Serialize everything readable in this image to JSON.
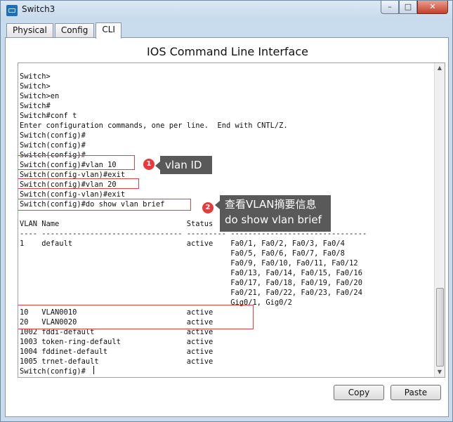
{
  "window": {
    "title": "Switch3",
    "minimize": "–",
    "maximize": "□",
    "close": "✕"
  },
  "tabs": [
    {
      "label": "Physical"
    },
    {
      "label": "Config"
    },
    {
      "label": "CLI"
    }
  ],
  "panel": {
    "title": "IOS Command Line Interface"
  },
  "terminal": {
    "lines": [
      "Switch>",
      "Switch>",
      "Switch>en",
      "Switch#",
      "Switch#conf t",
      "Enter configuration commands, one per line.  End with CNTL/Z.",
      "Switch(config)#",
      "Switch(config)#",
      "Switch(config)#",
      "Switch(config)#vlan 10",
      "Switch(config-vlan)#exit",
      "Switch(config)#vlan 20",
      "Switch(config-vlan)#exit",
      "Switch(config)#do show vlan brief",
      "",
      "VLAN Name                             Status    Ports",
      "---- -------------------------------- --------- -------------------------------",
      "1    default                          active    Fa0/1, Fa0/2, Fa0/3, Fa0/4",
      "                                                Fa0/5, Fa0/6, Fa0/7, Fa0/8",
      "                                                Fa0/9, Fa0/10, Fa0/11, Fa0/12",
      "                                                Fa0/13, Fa0/14, Fa0/15, Fa0/16",
      "                                                Fa0/17, Fa0/18, Fa0/19, Fa0/20",
      "                                                Fa0/21, Fa0/22, Fa0/23, Fa0/24",
      "                                                Gig0/1, Gig0/2",
      "10   VLAN0010                         active",
      "20   VLAN0020                         active",
      "1002 fddi-default                     active",
      "1003 token-ring-default               active",
      "1004 fddinet-default                  active",
      "1005 trnet-default                    active",
      "Switch(config)#"
    ]
  },
  "annotations": {
    "badge1": "1",
    "callout1": "vlan ID",
    "badge2": "2",
    "callout2_line1": "查看VLAN摘要信息",
    "callout2_line2": "do show vlan brief",
    "annotation_color": "#e34040",
    "callout_color": "#595959"
  },
  "buttons": {
    "copy": "Copy",
    "paste": "Paste"
  }
}
